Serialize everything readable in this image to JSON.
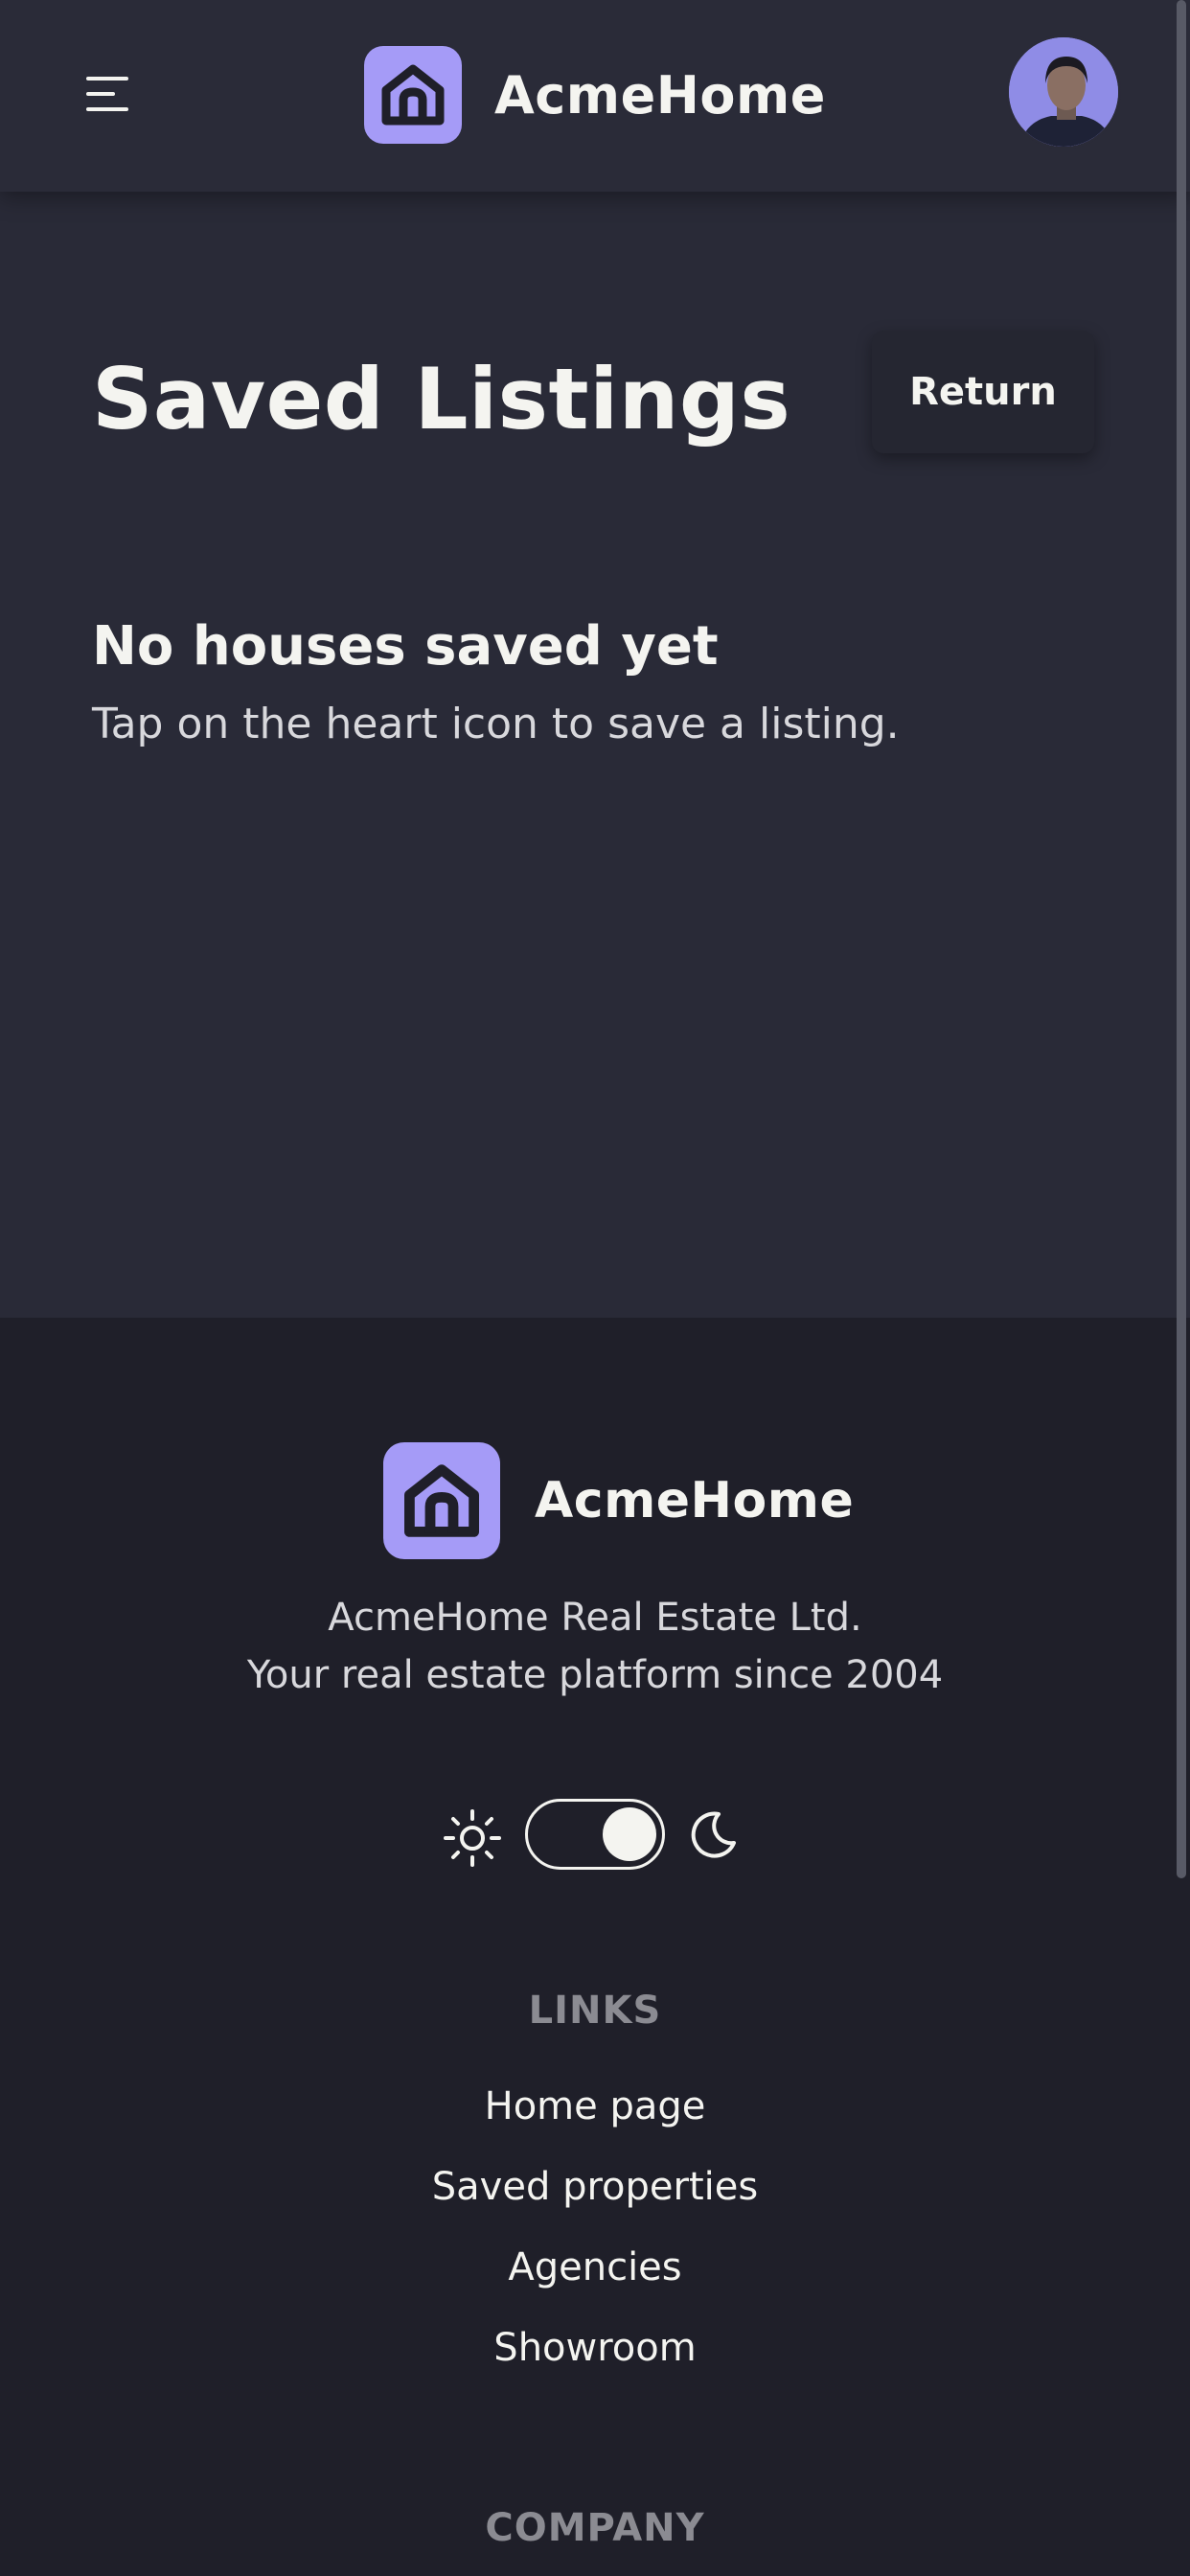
{
  "header": {
    "brand_name": "AcmeHome",
    "menu_icon": "hamburger-menu-icon",
    "logo_icon": "house-icon",
    "avatar": "user-avatar"
  },
  "main": {
    "title": "Saved Listings",
    "return_label": "Return",
    "empty_title": "No houses saved yet",
    "empty_subtitle": "Tap on the heart icon to save a listing."
  },
  "footer": {
    "brand_name": "AcmeHome",
    "company_line": "AcmeHome Real Estate Ltd.",
    "tagline": "Your real estate platform since 2004",
    "theme_toggle": {
      "state": "dark",
      "light_icon": "sun-icon",
      "dark_icon": "moon-icon"
    },
    "links_title": "LINKS",
    "links": [
      "Home page",
      "Saved properties",
      "Agencies",
      "Showroom"
    ],
    "company_title": "COMPANY"
  },
  "colors": {
    "accent": "#a59bf7",
    "header_bg": "#2a2b38",
    "main_bg": "#292a37",
    "footer_bg": "#1f1f29",
    "text": "#f4f4f0",
    "muted": "#8b8b92"
  }
}
